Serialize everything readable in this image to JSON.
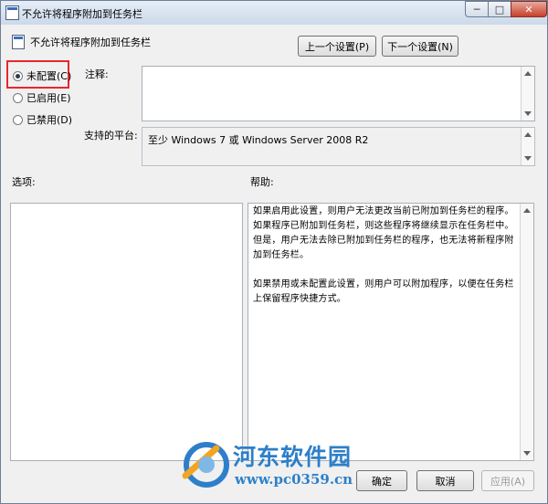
{
  "window": {
    "title": "不允许将程序附加到任务栏",
    "controls": {
      "minimize": "─",
      "maximize": "□",
      "close": "✕"
    }
  },
  "setting": {
    "name": "不允许将程序附加到任务栏"
  },
  "nav": {
    "prev_label": "上一个设置(P)",
    "next_label": "下一个设置(N)"
  },
  "state": {
    "options": [
      {
        "label": "未配置(C)",
        "checked": true
      },
      {
        "label": "已启用(E)",
        "checked": false
      },
      {
        "label": "已禁用(D)",
        "checked": false
      }
    ]
  },
  "labels": {
    "comment": "注释:",
    "platform": "支持的平台:",
    "options": "选项:",
    "help": "帮助:"
  },
  "comment_value": "",
  "platform_value": "至少 Windows 7 或 Windows Server 2008 R2",
  "help_paragraphs": [
    "如果启用此设置，则用户无法更改当前已附加到任务栏的程序。如果程序已附加到任务栏，则这些程序将继续显示在任务栏中。但是，用户无法去除已附加到任务栏的程序，也无法将新程序附加到任务栏。",
    "如果禁用或未配置此设置，则用户可以附加程序，以便在任务栏上保留程序快捷方式。"
  ],
  "buttons": {
    "ok": "确定",
    "cancel": "取消",
    "apply": "应用(A)"
  },
  "watermark": {
    "name": "河东软件园",
    "url": "www.pc0359.cn"
  },
  "colors": {
    "highlight": "#e8272d",
    "watermark": "#2d7fc9",
    "close": "#c6402c"
  }
}
